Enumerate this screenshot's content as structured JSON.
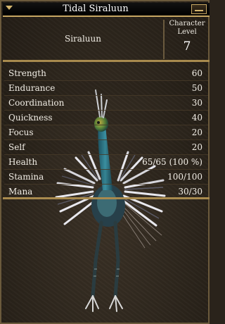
{
  "window": {
    "title": "Tidal Siraluun"
  },
  "header": {
    "species": "Siraluun",
    "level_label_line1": "Character",
    "level_label_line2": "Level",
    "level_value": "7"
  },
  "attributes": [
    {
      "label": "Strength",
      "value": "60"
    },
    {
      "label": "Endurance",
      "value": "50"
    },
    {
      "label": "Coordination",
      "value": "30"
    },
    {
      "label": "Quickness",
      "value": "40"
    },
    {
      "label": "Focus",
      "value": "20"
    },
    {
      "label": "Self",
      "value": "20"
    }
  ],
  "vitals": [
    {
      "label": "Health",
      "value": "65/65 (100 %)"
    },
    {
      "label": "Stamina",
      "value": "100/100"
    },
    {
      "label": "Mana",
      "value": "30/30"
    }
  ],
  "icons": {
    "title_left": "triangle-down-icon",
    "close": "minimize-icon",
    "portrait": "siraluun-creature-portrait"
  },
  "colors": {
    "accent_gold": "#c7a763",
    "panel_bg": "#2d261d",
    "text": "#f2eee6"
  }
}
